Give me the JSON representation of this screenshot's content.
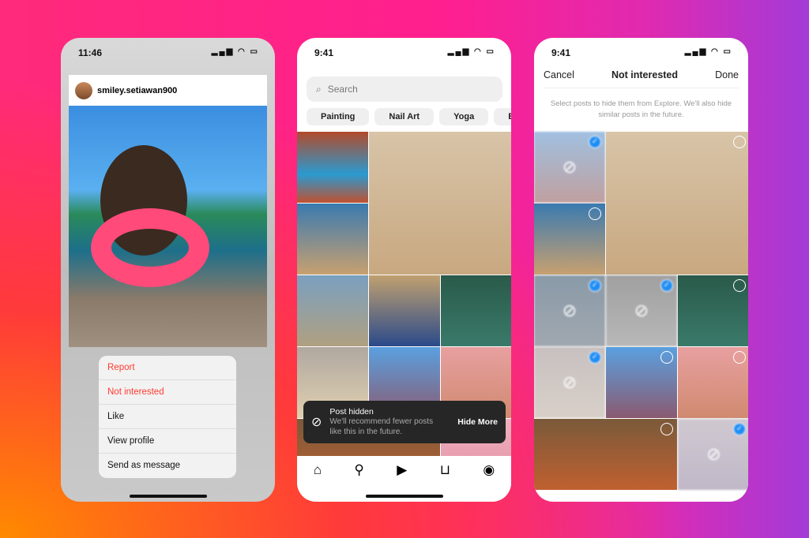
{
  "left_phone": {
    "time": "11:46",
    "status_icons": "▂▄▆ ◠ ▭",
    "username": "smiley.setiawan900",
    "menu": [
      {
        "label": "Report",
        "destructive": true
      },
      {
        "label": "Not interested",
        "destructive": true
      },
      {
        "label": "Like"
      },
      {
        "label": "View profile"
      },
      {
        "label": "Send as message"
      }
    ]
  },
  "middle_phone": {
    "time": "9:41",
    "status_icons": "▂▄▆ ◠ ▭",
    "search_placeholder": "Search",
    "chips": [
      "Painting",
      "Nail Art",
      "Yoga",
      "Base"
    ],
    "tiles": [
      {
        "bg": "linear-gradient(#b24a2a,#2a9ad0 60%,#c05030)"
      },
      {
        "bg": "linear-gradient(#d8c4a8,#c8a880)",
        "big": true
      },
      {
        "bg": "linear-gradient(#3a7ab0,#c8a070)"
      },
      {
        "bg": "linear-gradient(#7aa0c0,#b0a080)"
      },
      {
        "bg": "linear-gradient(#c0a070,#2a4a8a)"
      },
      {
        "bg": "linear-gradient(#2a5a4a,#3a7a6a)"
      },
      {
        "bg": "linear-gradient(#b0a8a0,#e0d0b0)"
      },
      {
        "bg": "linear-gradient(#5aa0e0,#8a5a70)"
      },
      {
        "bg": "linear-gradient(#e8a0a0,#d08a70)"
      },
      {
        "bg": "linear-gradient(#7a5a3a,#c06030)",
        "wide": true
      },
      {
        "bg": "linear-gradient(#f0b0c0,#e090a0)"
      }
    ],
    "toast": {
      "title": "Post hidden",
      "message": "We'll recommend fewer posts like this in the future.",
      "action": "Hide More"
    },
    "nav_icons": [
      "home-icon",
      "search-icon",
      "reels-icon",
      "shop-icon",
      "profile-icon"
    ]
  },
  "right_phone": {
    "time": "9:41",
    "status_icons": "▂▄▆ ◠ ▭",
    "cancel": "Cancel",
    "title": "Not interested",
    "done": "Done",
    "instructions": "Select posts to hide them from Explore. We'll also hide similar posts in the future.",
    "tiles": [
      {
        "bg": "linear-gradient(#a0c0e0,#c0a0a0)",
        "hidden": true,
        "selected": true
      },
      {
        "bg": "linear-gradient(#d8c4a8,#c8a880)",
        "big": true,
        "selected": false
      },
      {
        "bg": "linear-gradient(#3a7ab0,#c8a070)",
        "selected": false
      },
      {
        "bg": "linear-gradient(#8a9aa8,#a0a8b0)",
        "hidden": true,
        "selected": true
      },
      {
        "bg": "linear-gradient(#a0a0a0,#b8b8b8)",
        "hidden": true,
        "selected": true
      },
      {
        "bg": "linear-gradient(#2a5a4a,#3a7a6a)",
        "selected": false
      },
      {
        "bg": "linear-gradient(#c8c0c0,#d8d0c8)",
        "hidden": true,
        "selected": true
      },
      {
        "bg": "linear-gradient(#5aa0e0,#8a5a70)",
        "selected": false
      },
      {
        "bg": "linear-gradient(#e8a0a0,#d08a70)",
        "selected": false
      },
      {
        "bg": "linear-gradient(#7a5a3a,#c06030)",
        "wide": true,
        "selected": false
      },
      {
        "bg": "linear-gradient(#d0c8d0,#c0b8c8)",
        "hidden": true,
        "selected": true
      }
    ]
  },
  "colors": {
    "accent": "#1d8cf5",
    "destructive": "#ff3b30"
  }
}
